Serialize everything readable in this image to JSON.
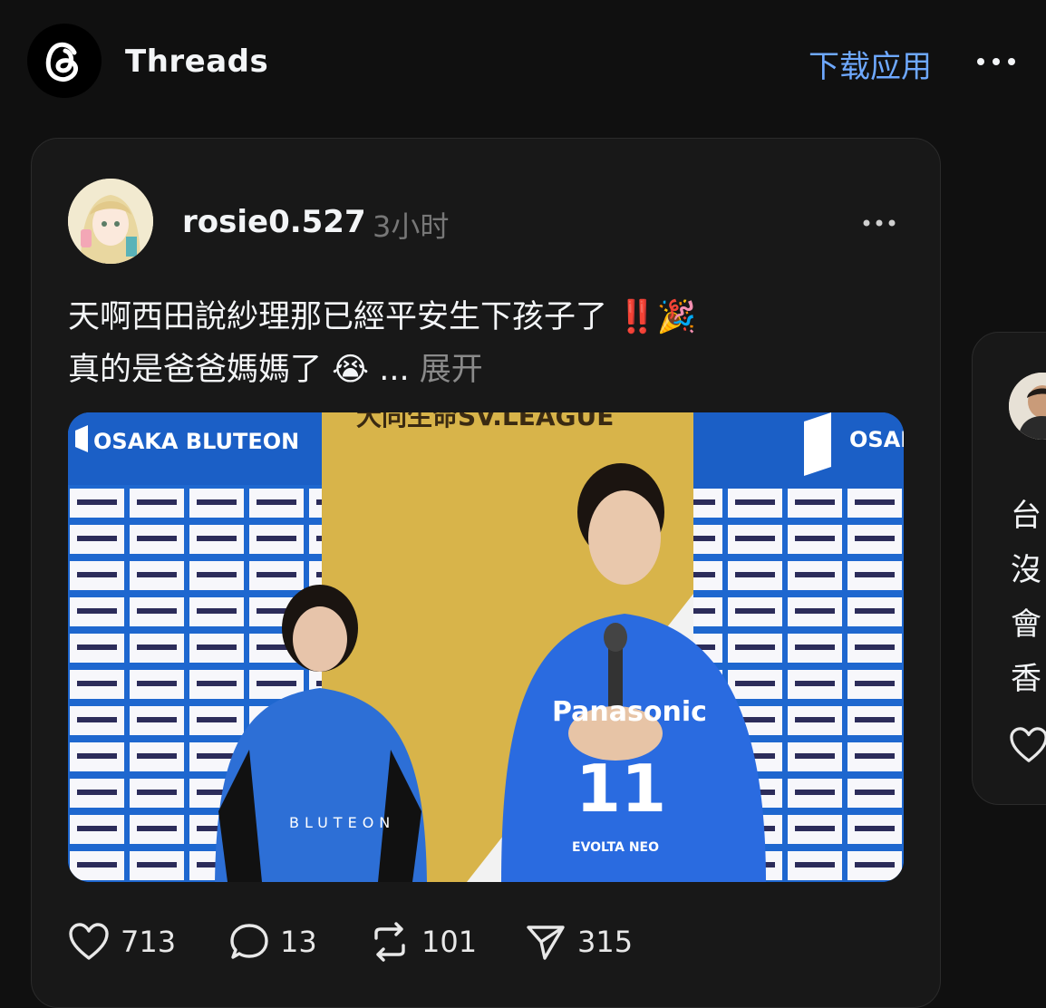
{
  "header": {
    "brand": "Threads",
    "download_label": "下载应用",
    "logo_icon": "threads-logo-icon",
    "more_icon": "more-horizontal-icon"
  },
  "post": {
    "username": "rosie0.527",
    "time": "3小时",
    "text_line1": "天啊西田說紗理那已經平安生下孩子了",
    "text_line1_emoji": "‼️🎉",
    "text_line2": "真的是爸爸媽媽了",
    "text_line2_emoji": "😭",
    "ellipsis": "...",
    "expand_label": "展开",
    "image": {
      "banner_left": "OSAKA BLUTEON",
      "banner_right": "OSAKA",
      "league": "大同生命SV.LEAGUE",
      "jersey_number": "11",
      "jersey_sponsor": "Panasonic",
      "jersey_bottom": "EVOLTA NEO",
      "shirt_text": "BLUTEON"
    },
    "likes": "713",
    "replies": "13",
    "reposts": "101",
    "shares": "315"
  },
  "side_post": {
    "chars": [
      "台",
      "沒",
      "會",
      "香"
    ]
  },
  "colors": {
    "background": "#101010",
    "card": "#181818",
    "accent": "#6ea8fe",
    "muted": "#777777"
  }
}
